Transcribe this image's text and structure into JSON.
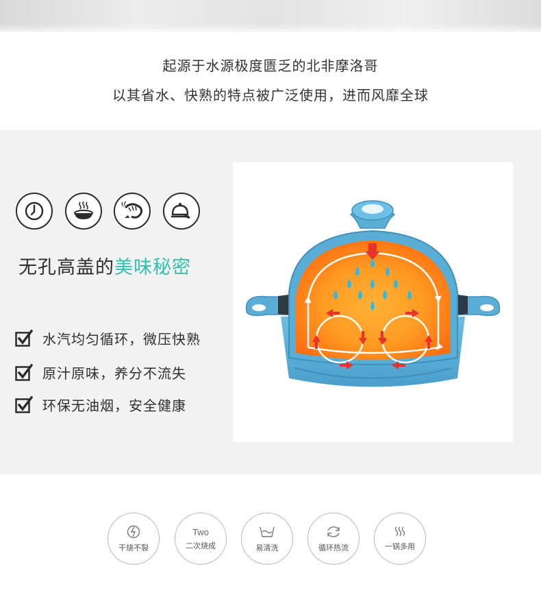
{
  "intro": {
    "line1": "起源于水源极度匮乏的北非摩洛哥",
    "line2": "以其省水、快熟的特点被广泛使用，进而风靡全球"
  },
  "feature_panel": {
    "icons": [
      "clock-icon",
      "steaming-bowl-icon",
      "shrimp-icon",
      "cloche-icon"
    ],
    "headline": {
      "prefix": "无孔高盖的",
      "accent": "美味秘密"
    },
    "checklist": [
      "水汽均匀循环，微压快熟",
      "原汁原味，养分不流失",
      "环保无油烟，安全健康"
    ],
    "colors": {
      "accent": "#2fc0b0",
      "pot_blue": "#5aaed6",
      "heat_orange": "#ff8a1c",
      "arrow_red": "#e8322a",
      "droplet": "#35b8e0"
    }
  },
  "badges": [
    {
      "icon": "no-crack-icon",
      "top": "",
      "label": "干烧不裂"
    },
    {
      "icon": "two-icon",
      "top": "Two",
      "label": "二次烧成"
    },
    {
      "icon": "basin-icon",
      "top": "",
      "label": "易清洗"
    },
    {
      "icon": "cycle-icon",
      "top": "",
      "label": "循环热流"
    },
    {
      "icon": "steam-icon",
      "top": "",
      "label": "一锅多用"
    }
  ]
}
